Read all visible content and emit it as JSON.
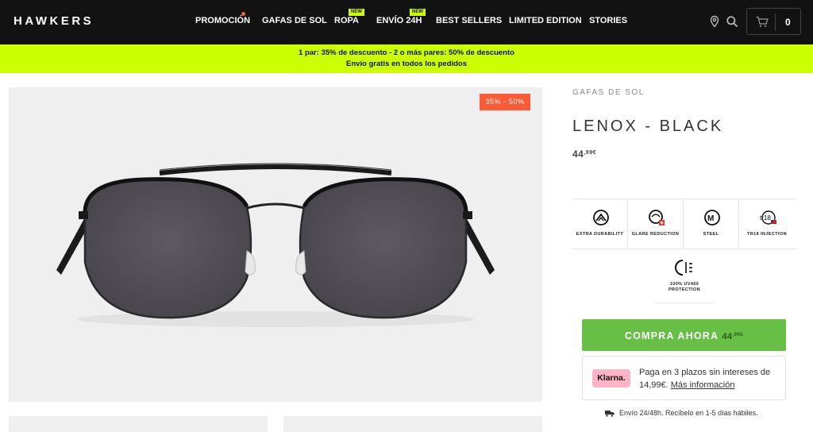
{
  "header": {
    "logo": "HAWKERS",
    "nav": [
      {
        "label": "PROMOCIÓN"
      },
      {
        "label": "GAFAS DE SOL"
      },
      {
        "label": "ROPA",
        "badge": "NEW"
      },
      {
        "label": "ENVÍO 24H",
        "badge": "NEW"
      },
      {
        "label": "BEST SELLERS"
      },
      {
        "label": "LIMITED EDITION"
      },
      {
        "label": "STORIES"
      }
    ],
    "cart_count": "0",
    "icons": [
      "location-icon",
      "search-icon",
      "cart-icon"
    ]
  },
  "promo": {
    "line1": "1 par: 35% de descuento - 2 o más pares: 50% de descuento",
    "line2": "Envío gratis en todos los pedidos"
  },
  "gallery": {
    "discount_badge": "35% - 50%"
  },
  "product": {
    "category": "GAFAS DE SOL",
    "title": "LENOX - BLACK",
    "price_int": "44",
    "price_dec": ",99€",
    "features": [
      {
        "icon": "durability-icon",
        "label": "EXTRA DURABILITY"
      },
      {
        "icon": "glare-icon",
        "label": "GLARE REDUCTION"
      },
      {
        "icon": "steel-icon",
        "label": "STEEL"
      },
      {
        "icon": "tr18-icon",
        "label": "TR18 INJECTION"
      }
    ],
    "uv": {
      "icon": "uv-protection-icon",
      "line1": "100% UV400",
      "line2": "PROTECTION"
    }
  },
  "buy": {
    "label": "COMPRA AHORA",
    "price_int": "44",
    "price_dec": ",99€",
    "color": "#67bf45"
  },
  "klarna": {
    "logo": "Klarna.",
    "text": "Paga en 3 plazos sin intereses de 14,99€.",
    "link": "Más información"
  },
  "shipping": {
    "text": "Envío 24/48h. Recíbelo en 1-5 días hábiles."
  },
  "colors": {
    "accent": "#ccff00",
    "badge": "#ff5a36",
    "nav_bg": "#121212"
  }
}
